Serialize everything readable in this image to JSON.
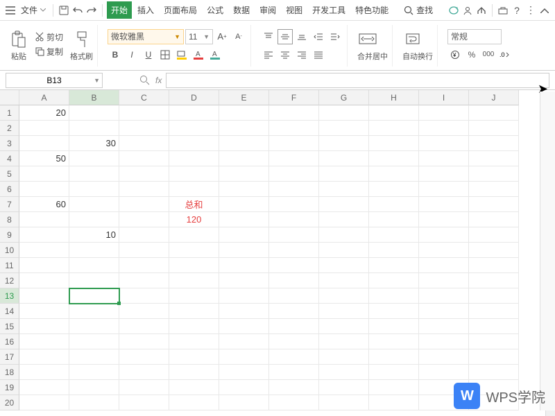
{
  "menu": {
    "file": "文件",
    "tabs": [
      "开始",
      "插入",
      "页面布局",
      "公式",
      "数据",
      "审阅",
      "视图",
      "开发工具",
      "特色功能"
    ],
    "search": "查找"
  },
  "ribbon": {
    "paste": "粘贴",
    "cut": "剪切",
    "copy": "复制",
    "formatpainter": "格式刷",
    "font": "微软雅黑",
    "fontsize": "11",
    "merge": "合并居中",
    "wrap": "自动换行",
    "numfmt": "常规"
  },
  "formula": {
    "cellref": "B13",
    "fx": "fx"
  },
  "sheet": {
    "cols": [
      "A",
      "B",
      "C",
      "D",
      "E",
      "F",
      "G",
      "H",
      "I",
      "J"
    ],
    "rows": 20,
    "selRow": 13,
    "selCol": 1,
    "data": {
      "A1": "20",
      "B3": "30",
      "A4": "50",
      "A7": "60",
      "D7": "总和",
      "D8": "120",
      "B9": "10"
    }
  },
  "watermark": "WPS学院",
  "chart_data": null
}
